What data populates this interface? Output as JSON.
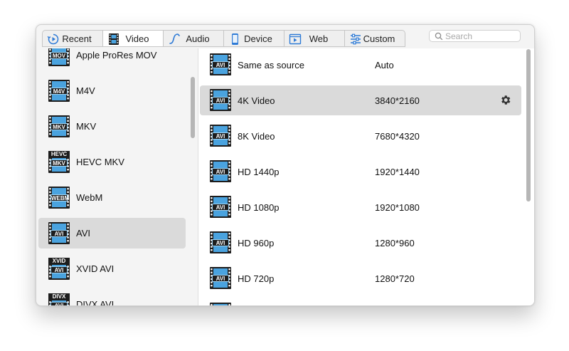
{
  "tabs": [
    {
      "label": "Recent",
      "icon": "clock-icon",
      "active": false
    },
    {
      "label": "Video",
      "icon": "film-icon",
      "active": true
    },
    {
      "label": "Audio",
      "icon": "music-note-icon",
      "active": false
    },
    {
      "label": "Device",
      "icon": "phone-icon",
      "active": false
    },
    {
      "label": "Web",
      "icon": "web-play-icon",
      "active": false
    },
    {
      "label": "Custom",
      "icon": "sliders-icon",
      "active": false
    }
  ],
  "search": {
    "placeholder": "Search",
    "value": ""
  },
  "categories": [
    {
      "label": "Apple ProRes MOV",
      "badge_top": "",
      "badge": "MOV",
      "selected": false
    },
    {
      "label": "M4V",
      "badge_top": "",
      "badge": "M4V",
      "selected": false
    },
    {
      "label": "MKV",
      "badge_top": "",
      "badge": "MKV",
      "selected": false
    },
    {
      "label": "HEVC MKV",
      "badge_top": "HEVC",
      "badge": "MKV",
      "selected": false
    },
    {
      "label": "WebM",
      "badge_top": "",
      "badge": "WEBM",
      "selected": false
    },
    {
      "label": "AVI",
      "badge_top": "",
      "badge": "AVI",
      "selected": true
    },
    {
      "label": "XVID AVI",
      "badge_top": "XVID",
      "badge": "AVI",
      "selected": false
    },
    {
      "label": "DIVX AVI",
      "badge_top": "DIVX",
      "badge": "AVI",
      "selected": false
    }
  ],
  "formats": [
    {
      "name": "Same as source",
      "resolution": "Auto",
      "badge": "AVI",
      "selected": false
    },
    {
      "name": "4K Video",
      "resolution": "3840*2160",
      "badge": "AVI",
      "selected": true
    },
    {
      "name": "8K Video",
      "resolution": "7680*4320",
      "badge": "AVI",
      "selected": false
    },
    {
      "name": "HD 1440p",
      "resolution": "1920*1440",
      "badge": "AVI",
      "selected": false
    },
    {
      "name": "HD 1080p",
      "resolution": "1920*1080",
      "badge": "AVI",
      "selected": false
    },
    {
      "name": "HD 960p",
      "resolution": "1280*960",
      "badge": "AVI",
      "selected": false
    },
    {
      "name": "HD 720p",
      "resolution": "1280*720",
      "badge": "AVI",
      "selected": false
    },
    {
      "name": "",
      "resolution": "",
      "badge": "AVI",
      "selected": false
    }
  ],
  "colors": {
    "accent": "#2f7bd6",
    "icon_dark": "#1d1d1d",
    "icon_blue": "#4aa3df",
    "selection": "#dadada"
  }
}
